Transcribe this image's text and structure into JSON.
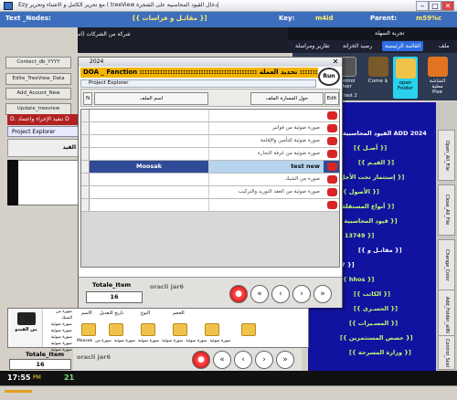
{
  "titlebar": {
    "title": "Ezy مع تحرير الكامل و الاشتاء وتحرير ( treeView إدخال القيود المحاسبية على الشجرة",
    "min": "–",
    "max": "□",
    "close": "✕"
  },
  "topband": {
    "text_nodes_label": "Text _Nodes:",
    "text_nodes_value": "[{ مقاتـل و فراسات }]",
    "key_label": "Key:",
    "key_value": "m4id",
    "parent_label": "Parent:",
    "parent_value": "m59%c"
  },
  "company": {
    "name": "شركة من الشركات (اسم الشركة )"
  },
  "menubar": {
    "top_label": "ملف",
    "tab_main": "القائمة الرئيسية",
    "tab_treasury": "رصيد الخزانة",
    "tab_reports": "تقارير ومراسلة",
    "tab_subtitle": "تجربة السهلة"
  },
  "left": {
    "btn1": "Contect_db_YYYY",
    "btn2": "Edite_TreeView_Data",
    "btn3": "Add_Acount_New",
    "btn4": "Update_treeview",
    "red_text": "D. تنفيذ الإجراء واعتماد D",
    "project_explorer": "Project Explorer",
    "grid_col": "القيد"
  },
  "ribbon": {
    "items": [
      {
        "label": "Control User",
        "sub": "ezy test 2"
      },
      {
        "label": "Come $"
      },
      {
        "label": "open Folder"
      },
      {
        "label": "الشاشة معلية",
        "sub": "Pise"
      }
    ]
  },
  "tree": {
    "nodes": [
      "القيود المحاسبية لسنة ADD 2024",
      "[{ أصـل }]",
      "[{ القيـم }]",
      "[{ إستثمار تحت الأجل }]",
      "[{ الأصول }]",
      "[{ أنواع المستقلة من ال }]",
      "[{ قيود المحاسبية تابع لل }]",
      "[{ 13749 }]",
      "[{ مقاتـل و }]",
      "324628327 }]",
      "[{ hhos }]",
      "[{ الكاتب }]",
      "[{ الحسـرى }]",
      "[{ المسـيرات }]",
      "[{ حصص المستثمرين }]",
      "[{ وزارة المسرحة }]"
    ]
  },
  "sidetabs": [
    "Open_All_File",
    "Close_All_File",
    "Change_Color",
    "Add_Folder_allN",
    "Control_Scel"
  ],
  "dialog": {
    "title": "2024",
    "close": "✕",
    "function_bar": "DOA _ Fanction :::::::::::::::::::::::::::::::::::::::::::::: تحديد العملة ::::::::::::",
    "run": "Run",
    "project_explorer": "Project Explorer",
    "btn_n": "N",
    "btn_name": "اسم الملف",
    "btn_path": "حول المسارة الملف",
    "btn_edit": "Edit",
    "rows": [
      {
        "left": "",
        "right": ""
      },
      {
        "left": "",
        "right": "صورة ضوئية من فواتير"
      },
      {
        "left": "",
        "right": "صورة ضوئية للتأمين والإقامة"
      },
      {
        "left": "",
        "right": "صورة ضوئية من غرفة التجارة"
      },
      {
        "left": "Moosak",
        "right": "test new"
      },
      {
        "left": "",
        "right": "صورة من الشيك"
      },
      {
        "left": "",
        "right": "صورة ضوئية من العقد التوريد والتركيب"
      },
      {
        "left": "",
        "right": ""
      }
    ],
    "totale_label": "Totale_Item",
    "totale_value": "16",
    "oracle": "oracli jar6"
  },
  "bottom": {
    "headers": [
      "الحجم",
      "النوع",
      "تاريخ التعديل",
      "الاسم"
    ],
    "names": [
      "Moosak",
      "صورة ضوئية",
      "صورة ضوئية",
      "صورة ضوئية",
      "صورة ضوئية",
      "صورة ضوئية",
      "صورة من"
    ],
    "left_lines": [
      "صورة من الشيك",
      "صورة ضوئية",
      "صورة ضوئية",
      "صورة ضوئية",
      "صورة ضوئية",
      "صورة ضوئية"
    ],
    "logo_text": "من الفيدو",
    "totale_label": "Totale_Item",
    "totale_value": "16",
    "oracle": "oracli jar6"
  },
  "status": {
    "time": "17:55",
    "pm": "PM",
    "day": "21"
  },
  "colors": {
    "blue_band": "#3d6ebd",
    "tree_bg": "#1212a0",
    "red_bar": "#b02222",
    "gold": "#f3b400"
  }
}
